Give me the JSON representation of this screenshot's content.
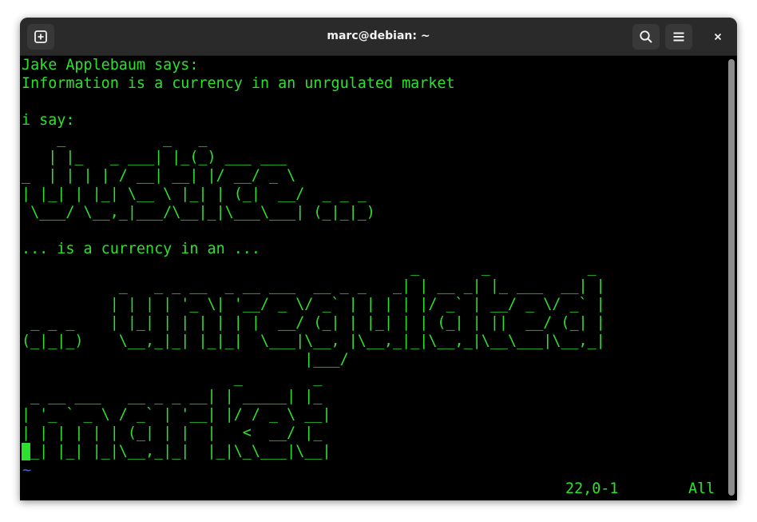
{
  "window": {
    "title": "marc@debian: ~"
  },
  "icons": {
    "new_tab": "new-tab-icon",
    "search": "search-icon",
    "menu": "hamburger-menu-icon",
    "close": "close-icon"
  },
  "colors": {
    "terminal_text": "#2ee02e",
    "terminal_background": "#000000",
    "tilde": "#4169e1",
    "titlebar": "#2a2a2a"
  },
  "terminal": {
    "lines": [
      "Jake Applebaum says:",
      "Information is a currency in an unrgulated market",
      "",
      "i say:",
      "    _           _   _",
      "   | |_   _ ___| |_(_) ___ ___",
      "_  | | | | / __| __| |/ __/ _ \\",
      "| |_| | |_| \\__ \\ |_| | (_|  __/  _ _ _",
      " \\___/ \\__,_|___/\\__|_|\\___\\___| (_|_|_)",
      "",
      "... is a currency in an ...",
      "                                            _       _           _",
      "           _   _ _ __  _ __ ___  __ _ _   _| | __ _| |_ ___  __| |",
      "          | | | | '_ \\| '__/ _ \\/ _` | | | | |/ _` | __/ _ \\/ _` |",
      " _ _ _    | |_| | | | | | |  __/ (_| | |_| | | (_| | ||  __/ (_| |",
      "(_|_|_)    \\__,_|_| |_|_|  \\___|\\__, |\\__,_|_|\\__,_|\\__\\___|\\__,_|",
      "                                |___/",
      "                        _        _",
      " _ __ ___   __ _ _ __| | _____| |_",
      "| '_ ` _ \\ / _` | '__| |/ / _ \\ __|",
      "| | | | | | (_| | |  |   <  __/ |_",
      "|_| |_| |_|\\__,_|_|  |_|\\_\\___|\\__|"
    ],
    "empty_line_marker": "~",
    "cursor_position": "22,0-1",
    "scroll_position": "All"
  }
}
